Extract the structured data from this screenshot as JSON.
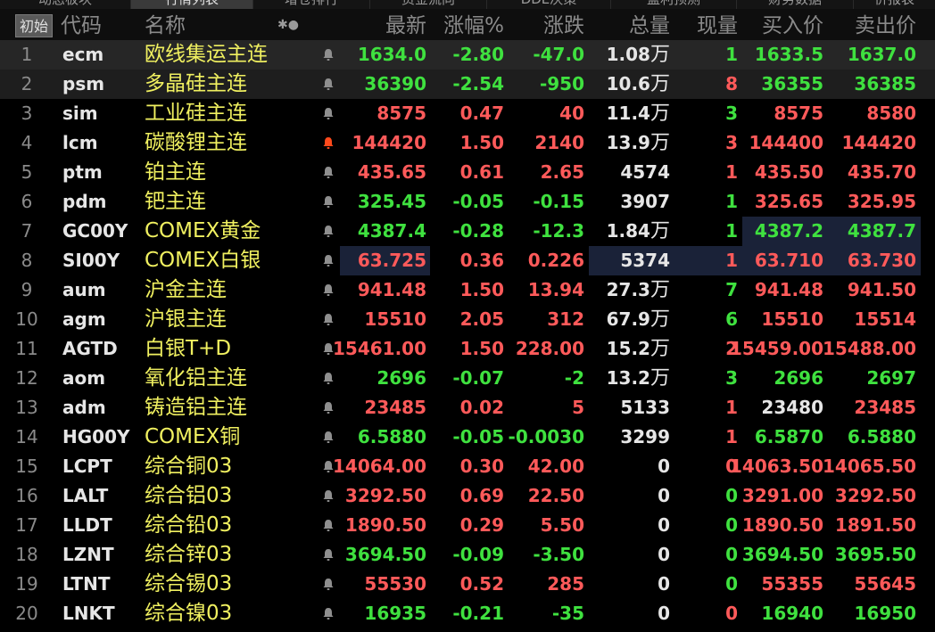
{
  "tabs": [
    "动态板块",
    "行情列表",
    "增仓排行",
    "资金流向",
    "DDE决策",
    "盈利预测",
    "财务数据",
    "价报表"
  ],
  "active_tab": 1,
  "header": {
    "init_label": "初始",
    "code": "代码",
    "name": "名称",
    "icons": "✱●",
    "last": "最新",
    "pct": "涨幅%",
    "chg": "涨跌",
    "vol": "总量",
    "cur": "现量",
    "bid": "买入价",
    "ask": "卖出价"
  },
  "colors": {
    "up": "#ff5a5a",
    "down": "#3fe13f",
    "name": "#f0f060",
    "alert_bell": "#ff4a1c"
  },
  "rows": [
    {
      "num": "1",
      "code": "ecm",
      "name": "欧线集运主连",
      "bell": "bell-icon",
      "last": "1634.0",
      "pct": "-2.80",
      "chg": "-47.0",
      "vol": "1.08",
      "unit": "万",
      "cur": "1",
      "bid": "1633.5",
      "ask": "1637.0",
      "dir": "down",
      "cur_dir": "down",
      "bid_dir": "down",
      "ask_dir": "down"
    },
    {
      "num": "2",
      "code": "psm",
      "name": "多晶硅主连",
      "bell": "bell-icon",
      "last": "36390",
      "pct": "-2.54",
      "chg": "-950",
      "vol": "10.6",
      "unit": "万",
      "cur": "8",
      "bid": "36355",
      "ask": "36385",
      "dir": "down",
      "cur_dir": "up",
      "bid_dir": "down",
      "ask_dir": "down"
    },
    {
      "num": "3",
      "code": "sim",
      "name": "工业硅主连",
      "bell": "bell-icon",
      "last": "8575",
      "pct": "0.47",
      "chg": "40",
      "vol": "11.4",
      "unit": "万",
      "cur": "3",
      "bid": "8575",
      "ask": "8580",
      "dir": "up",
      "cur_dir": "down",
      "bid_dir": "up",
      "ask_dir": "up"
    },
    {
      "num": "4",
      "code": "lcm",
      "name": "碳酸锂主连",
      "bell": "alert-bell-icon",
      "last": "144420",
      "pct": "1.50",
      "chg": "2140",
      "vol": "13.9",
      "unit": "万",
      "cur": "3",
      "bid": "144400",
      "ask": "144420",
      "dir": "up",
      "cur_dir": "up",
      "bid_dir": "up",
      "ask_dir": "up"
    },
    {
      "num": "5",
      "code": "ptm",
      "name": "铂主连",
      "bell": "bell-icon",
      "last": "435.65",
      "pct": "0.61",
      "chg": "2.65",
      "vol": "4574",
      "unit": "",
      "cur": "1",
      "bid": "435.50",
      "ask": "435.70",
      "dir": "up",
      "cur_dir": "up",
      "bid_dir": "up",
      "ask_dir": "up"
    },
    {
      "num": "6",
      "code": "pdm",
      "name": "钯主连",
      "bell": "bell-icon",
      "last": "325.45",
      "pct": "-0.05",
      "chg": "-0.15",
      "vol": "3907",
      "unit": "",
      "cur": "1",
      "bid": "325.65",
      "ask": "325.95",
      "dir": "down",
      "cur_dir": "down",
      "bid_dir": "up",
      "ask_dir": "up"
    },
    {
      "num": "7",
      "code": "GC00Y",
      "name": "COMEX黄金",
      "bell": "bell-icon",
      "last": "4387.4",
      "pct": "-0.28",
      "chg": "-12.3",
      "vol": "1.84",
      "unit": "万",
      "cur": "1",
      "bid": "4387.2",
      "ask": "4387.7",
      "dir": "down",
      "cur_dir": "down",
      "bid_dir": "down",
      "ask_dir": "down"
    },
    {
      "num": "8",
      "code": "SI00Y",
      "name": "COMEX白银",
      "bell": "bell-icon",
      "last": "63.725",
      "pct": "0.36",
      "chg": "0.226",
      "vol": "5374",
      "unit": "",
      "cur": "1",
      "bid": "63.710",
      "ask": "63.730",
      "dir": "up",
      "cur_dir": "up",
      "bid_dir": "up",
      "ask_dir": "up"
    },
    {
      "num": "9",
      "code": "aum",
      "name": "沪金主连",
      "bell": "bell-icon",
      "last": "941.48",
      "pct": "1.50",
      "chg": "13.94",
      "vol": "27.3",
      "unit": "万",
      "cur": "7",
      "bid": "941.48",
      "ask": "941.50",
      "dir": "up",
      "cur_dir": "down",
      "bid_dir": "up",
      "ask_dir": "up"
    },
    {
      "num": "10",
      "code": "agm",
      "name": "沪银主连",
      "bell": "bell-icon",
      "last": "15510",
      "pct": "2.05",
      "chg": "312",
      "vol": "67.9",
      "unit": "万",
      "cur": "6",
      "bid": "15510",
      "ask": "15514",
      "dir": "up",
      "cur_dir": "down",
      "bid_dir": "up",
      "ask_dir": "up"
    },
    {
      "num": "11",
      "code": "AGTD",
      "name": "白银T+D",
      "bell": "bell-icon",
      "last": "15461.00",
      "pct": "1.50",
      "chg": "228.00",
      "vol": "15.2",
      "unit": "万",
      "cur": "2",
      "bid": "15459.00",
      "ask": "15488.00",
      "dir": "up",
      "cur_dir": "up",
      "bid_dir": "up",
      "ask_dir": "up"
    },
    {
      "num": "12",
      "code": "aom",
      "name": "氧化铝主连",
      "bell": "bell-icon",
      "last": "2696",
      "pct": "-0.07",
      "chg": "-2",
      "vol": "13.2",
      "unit": "万",
      "cur": "3",
      "bid": "2696",
      "ask": "2697",
      "dir": "down",
      "cur_dir": "down",
      "bid_dir": "down",
      "ask_dir": "down"
    },
    {
      "num": "13",
      "code": "adm",
      "name": "铸造铝主连",
      "bell": "bell-icon",
      "last": "23485",
      "pct": "0.02",
      "chg": "5",
      "vol": "5133",
      "unit": "",
      "cur": "1",
      "bid": "23480",
      "ask": "23485",
      "dir": "up",
      "cur_dir": "up",
      "bid_dir": "white",
      "ask_dir": "up"
    },
    {
      "num": "14",
      "code": "HG00Y",
      "name": "COMEX铜",
      "bell": "bell-icon",
      "last": "6.5880",
      "pct": "-0.05",
      "chg": "-0.0030",
      "vol": "3299",
      "unit": "",
      "cur": "1",
      "bid": "6.5870",
      "ask": "6.5880",
      "dir": "down",
      "cur_dir": "up",
      "bid_dir": "down",
      "ask_dir": "down"
    },
    {
      "num": "15",
      "code": "LCPT",
      "name": "综合铜03",
      "bell": "bell-icon",
      "last": "14064.00",
      "pct": "0.30",
      "chg": "42.00",
      "vol": "0",
      "unit": "",
      "cur": "0",
      "bid": "14063.50",
      "ask": "14065.50",
      "dir": "up",
      "cur_dir": "up",
      "bid_dir": "up",
      "ask_dir": "up"
    },
    {
      "num": "16",
      "code": "LALT",
      "name": "综合铝03",
      "bell": "bell-icon",
      "last": "3292.50",
      "pct": "0.69",
      "chg": "22.50",
      "vol": "0",
      "unit": "",
      "cur": "0",
      "bid": "3291.00",
      "ask": "3292.50",
      "dir": "up",
      "cur_dir": "down",
      "bid_dir": "up",
      "ask_dir": "up"
    },
    {
      "num": "17",
      "code": "LLDT",
      "name": "综合铅03",
      "bell": "bell-icon",
      "last": "1890.50",
      "pct": "0.29",
      "chg": "5.50",
      "vol": "0",
      "unit": "",
      "cur": "0",
      "bid": "1890.50",
      "ask": "1891.50",
      "dir": "up",
      "cur_dir": "down",
      "bid_dir": "up",
      "ask_dir": "up"
    },
    {
      "num": "18",
      "code": "LZNT",
      "name": "综合锌03",
      "bell": "bell-icon",
      "last": "3694.50",
      "pct": "-0.09",
      "chg": "-3.50",
      "vol": "0",
      "unit": "",
      "cur": "0",
      "bid": "3694.50",
      "ask": "3695.50",
      "dir": "down",
      "cur_dir": "down",
      "bid_dir": "down",
      "ask_dir": "down"
    },
    {
      "num": "19",
      "code": "LTNT",
      "name": "综合锡03",
      "bell": "bell-icon",
      "last": "55530",
      "pct": "0.52",
      "chg": "285",
      "vol": "0",
      "unit": "",
      "cur": "0",
      "bid": "55355",
      "ask": "55645",
      "dir": "up",
      "cur_dir": "down",
      "bid_dir": "up",
      "ask_dir": "up"
    },
    {
      "num": "20",
      "code": "LNKT",
      "name": "综合镍03",
      "bell": "bell-icon",
      "last": "16935",
      "pct": "-0.21",
      "chg": "-35",
      "vol": "0",
      "unit": "",
      "cur": "0",
      "bid": "16940",
      "ask": "16950",
      "dir": "down",
      "cur_dir": "up",
      "bid_dir": "down",
      "ask_dir": "down"
    }
  ]
}
